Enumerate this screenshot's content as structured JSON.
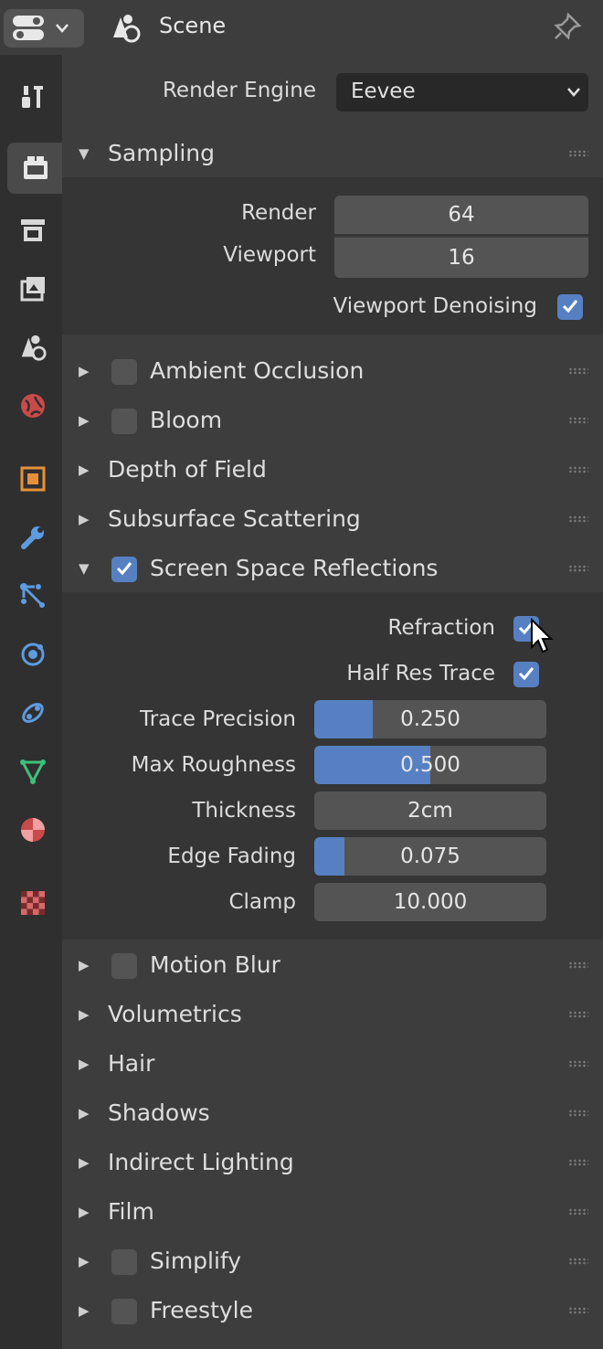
{
  "header": {
    "scene_label": "Scene"
  },
  "render_engine": {
    "label": "Render Engine",
    "value": "Eevee"
  },
  "sampling": {
    "title": "Sampling",
    "render_label": "Render",
    "render_value": "64",
    "viewport_label": "Viewport",
    "viewport_value": "16",
    "denoise_label": "Viewport Denoising",
    "denoise_checked": true
  },
  "panels": {
    "ambient_occlusion": "Ambient Occlusion",
    "bloom": "Bloom",
    "depth_of_field": "Depth of Field",
    "subsurface": "Subsurface Scattering",
    "ssr": "Screen Space Reflections",
    "motion_blur": "Motion Blur",
    "volumetrics": "Volumetrics",
    "hair": "Hair",
    "shadows": "Shadows",
    "indirect_lighting": "Indirect Lighting",
    "film": "Film",
    "simplify": "Simplify",
    "freestyle": "Freestyle"
  },
  "ssr": {
    "refraction_label": "Refraction",
    "half_res_label": "Half Res Trace",
    "trace_precision_label": "Trace Precision",
    "trace_precision_value": "0.250",
    "trace_precision_fraction": 0.25,
    "max_roughness_label": "Max Roughness",
    "max_roughness_value": "0.500",
    "max_roughness_fraction": 0.5,
    "thickness_label": "Thickness",
    "thickness_value": "2cm",
    "edge_fading_label": "Edge Fading",
    "edge_fading_value": "0.075",
    "edge_fading_fraction": 0.13,
    "clamp_label": "Clamp",
    "clamp_value": "10.000"
  },
  "colors": {
    "accent": "#5680c2",
    "background": "#3d3d3d",
    "field": "#545454"
  }
}
